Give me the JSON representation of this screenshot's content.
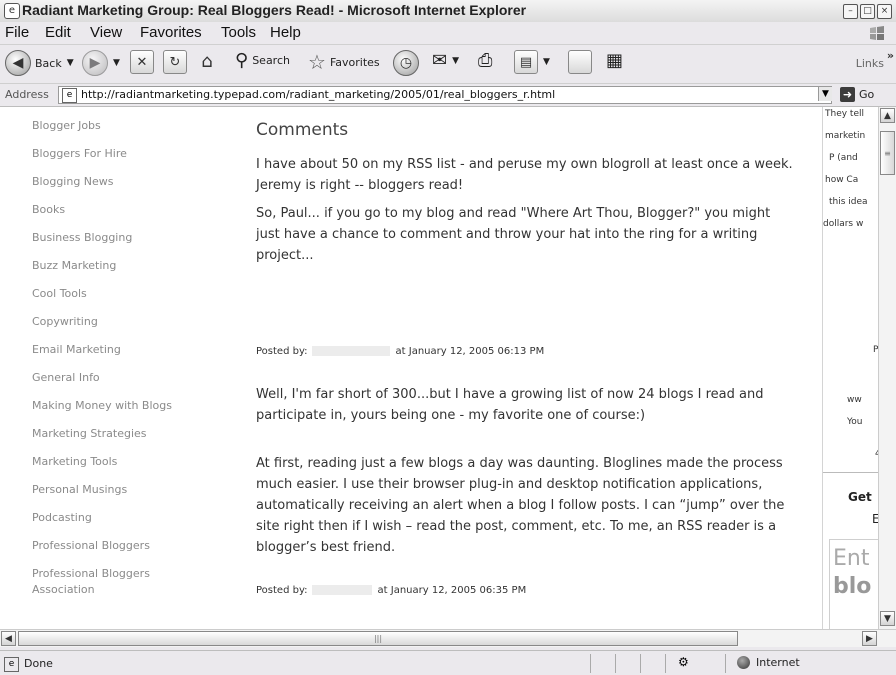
{
  "window": {
    "title": "Radiant Marketing Group: Real Bloggers Read! - Microsoft Internet Explorer"
  },
  "menubar": [
    "File",
    "Edit",
    "View",
    "Favorites",
    "Tools",
    "Help"
  ],
  "toolbar": {
    "back_label": "Back",
    "search_label": "Search",
    "favorites_label": "Favorites",
    "links_label": "Links"
  },
  "address": {
    "label": "Address",
    "url": "http://radiantmarketing.typepad.com/radiant_marketing/2005/01/real_bloggers_r.html",
    "go_label": "Go"
  },
  "sidebar": {
    "categories": [
      "Blogger Jobs",
      "Bloggers For Hire",
      "Blogging News",
      "Books",
      "Business Blogging",
      "Buzz Marketing",
      "Cool Tools",
      "Copywriting",
      "Email Marketing",
      "General Info",
      "Making Money with Blogs",
      "Marketing Strategies",
      "Marketing Tools",
      "Personal Musings",
      "Podcasting",
      "Professional Bloggers",
      "Professional Bloggers",
      "Association"
    ]
  },
  "comments": {
    "heading": "Comments",
    "c1_p1": "I have about 50 on my RSS list - and peruse my own blogroll at least once a week. Jeremy is right -- bloggers read!",
    "c1_p2": "So, Paul... if you go to my blog and read \"Where Art Thou, Blogger?\" you might just have a chance to comment and throw your hat into the ring for a writing project...",
    "c1_posted_by": "Posted by:",
    "c1_posted_at": "at January 12, 2005 06:13 PM",
    "c2_p1": "Well, I'm far short of 300...but I have a growing list of now 24 blogs I read and participate in, yours being one - my favorite one of course:)",
    "c2_p2": "At first, reading just a few blogs a day was daunting. Bloglines made the process much easier. I use their browser plug-in and desktop notification applications, automatically receiving an alert when a blog I follow posts. I can “jump” over the site right then if I wish – read the post, comment, etc. To me, an RSS reader is a blogger’s best friend.",
    "c2_posted_by": "Posted by:",
    "c2_posted_at": "at January 12, 2005 06:35 PM"
  },
  "right_panel": {
    "lines": [
      "They tell",
      "marketin",
      "P (and",
      "how Ca",
      "this idea",
      "dollars w"
    ],
    "frag_p": "P",
    "frag_ww": "ww",
    "frag_you": "You",
    "frag_4": "4",
    "get": "Get",
    "e": "E",
    "ent": "Ent",
    "blo": "blo"
  },
  "status": {
    "text": "Done",
    "zone": "Internet"
  }
}
